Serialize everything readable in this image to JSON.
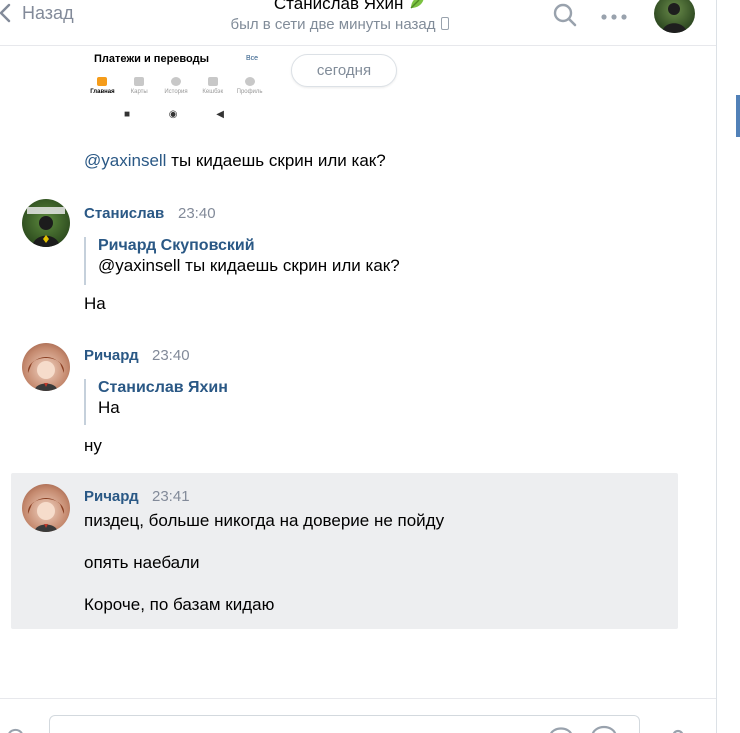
{
  "header": {
    "back_label": "Назад",
    "title": "Станислав Яхин",
    "status": "был в сети две минуты назад"
  },
  "shared_screenshot": {
    "title": "Платежи и переводы",
    "all_link": "Все",
    "tabs": [
      "Главная",
      "Карты",
      "История",
      "Кешбэк",
      "Профиль"
    ],
    "nav": [
      "■",
      "◉",
      "◀"
    ]
  },
  "date_divider": "сегодня",
  "messages": [
    {
      "mention": "@yaxinsell",
      "text": " ты кидаешь скрин или как?"
    },
    {
      "author": "Станислав",
      "time": "23:40",
      "quote_author": "Ричард Скуповский",
      "quote_text": "@yaxinsell ты кидаешь скрин или как?",
      "text": "На"
    },
    {
      "author": "Ричард",
      "time": "23:40",
      "quote_author": "Станислав Яхин",
      "quote_text": "На",
      "text": "ну"
    },
    {
      "author": "Ричард",
      "time": "23:41",
      "lines": [
        "пиздец, больше никогда на доверие не пойду",
        "опять наебали",
        "Короче, по базам кидаю"
      ]
    }
  ],
  "colors": {
    "link": "#2a5885",
    "muted": "#828a99",
    "selected_bg": "#edeef0",
    "accent": "#5181b8"
  },
  "icons": {
    "back": "chevron-left-icon",
    "search": "search-icon",
    "more": "more-dots-icon",
    "leaf": "leaf-icon",
    "phone": "mobile-phone-icon"
  }
}
